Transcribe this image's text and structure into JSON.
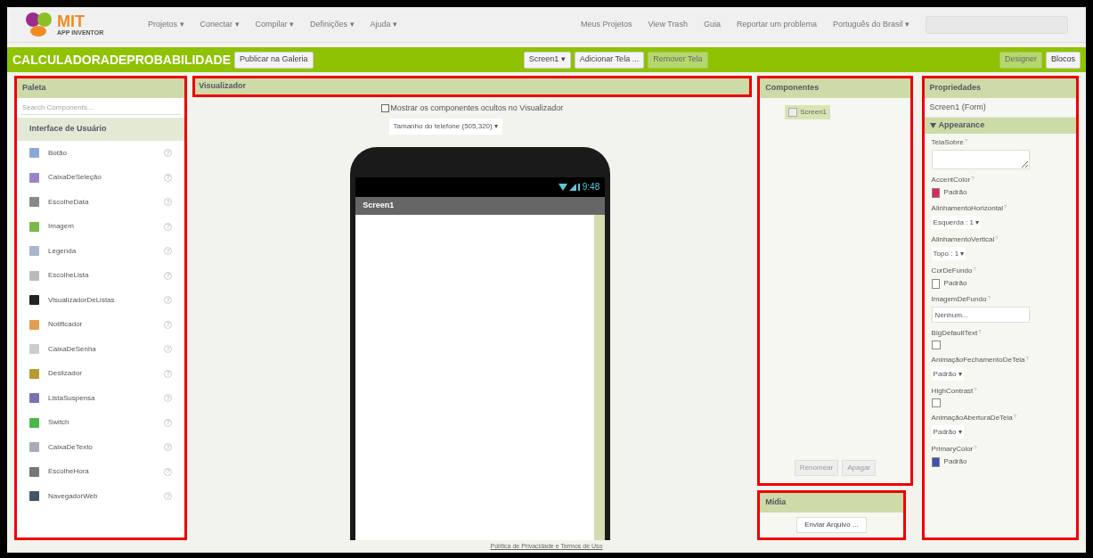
{
  "header": {
    "logo": {
      "title": "MIT",
      "subtitle": "APP INVENTOR"
    },
    "menus": [
      "Projetos ▾",
      "Conectar ▾",
      "Compilar ▾",
      "Definições ▾",
      "Ajuda ▾"
    ],
    "links": [
      "Meus Projetos",
      "View Trash",
      "Guia",
      "Reportar um problema",
      "Português do Brasil ▾"
    ]
  },
  "toolbar": {
    "project": "CALCULADORADEPROBABILIDADE",
    "publish": "Publicar na Galeria",
    "screen": "Screen1 ▾",
    "add_screen": "Adicionar Tela ...",
    "remove_screen": "Remover Tela",
    "modes": [
      {
        "label": "Designer",
        "selected": true
      },
      {
        "label": "Blocos",
        "selected": false
      }
    ]
  },
  "palette": {
    "title": "Paleta",
    "search": {
      "placeholder": "Search Components..."
    },
    "category": "Interface de Usuário",
    "items": [
      {
        "label": "Botão",
        "help": "?"
      },
      {
        "label": "CaixaDeSeleção",
        "help": "?"
      },
      {
        "label": "EscolheData",
        "help": "?"
      },
      {
        "label": "Imagem",
        "help": "?"
      },
      {
        "label": "Legenda",
        "help": "?"
      },
      {
        "label": "EscolheLista",
        "help": "?"
      },
      {
        "label": "VisualizadorDeListas",
        "help": "?"
      },
      {
        "label": "Notificador",
        "help": "?"
      },
      {
        "label": "CaixaDeSenha",
        "help": "?"
      },
      {
        "label": "Deslizador",
        "help": "?"
      },
      {
        "label": "ListaSuspensa",
        "help": "?"
      },
      {
        "label": "Switch",
        "help": "?"
      },
      {
        "label": "CaixaDeTexto",
        "help": "?"
      },
      {
        "label": "EscolheHora",
        "help": "?"
      },
      {
        "label": "NavegadorWeb",
        "help": "?"
      }
    ]
  },
  "viewer": {
    "title": "Visualizador",
    "show_hidden": {
      "label": "Mostrar os componentes ocultos no Visualizador",
      "checked": false
    },
    "phone_size": "Tamanho do telefone (505,320) ▾",
    "phone": {
      "time": "9:48",
      "screen_title": "Screen1"
    }
  },
  "components": {
    "title": "Componentes",
    "tree": [
      {
        "label": "Screen1",
        "selected": true
      }
    ],
    "buttons": [
      "Renomear",
      "Apagar"
    ]
  },
  "media": {
    "title": "Mídia",
    "upload": "Enviar Arquivo ..."
  },
  "properties": {
    "title": "Propriedades",
    "component": "Screen1 (Form)",
    "section": {
      "label": "Appearance",
      "expanded": true
    },
    "items": [
      {
        "kind": "textarea",
        "label": "TelaSobre",
        "help": "?"
      },
      {
        "kind": "color",
        "label": "AccentColor",
        "help": "?",
        "value": "Padrão",
        "color": "#e0245e"
      },
      {
        "kind": "select",
        "label": "AlinhamentoHorizontal",
        "help": "?",
        "value": "Esquerda : 1 ▾"
      },
      {
        "kind": "select",
        "label": "AlinhamentoVertical",
        "help": "?",
        "value": "Topo : 1 ▾"
      },
      {
        "kind": "color",
        "label": "CorDeFundo",
        "help": "?",
        "value": "Padrão",
        "color": "#ffffff"
      },
      {
        "kind": "input",
        "label": "ImagemDeFundo",
        "help": "?",
        "value": "Nenhum..."
      },
      {
        "kind": "checkbox",
        "label": "BigDefaultText",
        "help": "?",
        "checked": false
      },
      {
        "kind": "select",
        "label": "AnimaçãoFechamentoDeTela",
        "help": "?",
        "value": "Padrão ▾"
      },
      {
        "kind": "checkbox",
        "label": "HighContrast",
        "help": "?",
        "checked": false
      },
      {
        "kind": "select",
        "label": "AnimaçãoAberturaDeTela",
        "help": "?",
        "value": "Padrão ▾"
      },
      {
        "kind": "color",
        "label": "PrimaryColor",
        "help": "?",
        "value": "Padrão",
        "color": "#3f51b5"
      }
    ]
  },
  "footer": "Política de Privacidade e Termos de Uso"
}
